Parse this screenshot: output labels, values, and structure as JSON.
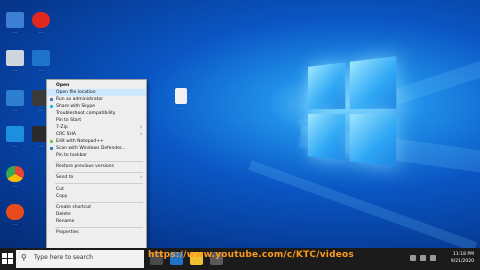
{
  "context_menu": {
    "items": [
      {
        "label": "Open",
        "bold": true,
        "submenu": false
      },
      {
        "label": "Open file location",
        "submenu": false,
        "highlight": true
      },
      {
        "label": "Run as administrator",
        "submenu": false,
        "icon": "shield"
      },
      {
        "label": "Share with Skype",
        "submenu": false,
        "icon": "skype"
      },
      {
        "label": "Troubleshoot compatibility",
        "submenu": false
      },
      {
        "label": "Pin to Start",
        "submenu": false
      },
      {
        "label": "7-Zip",
        "submenu": true
      },
      {
        "label": "CRC SHA",
        "submenu": true
      },
      {
        "label": "Edit with Notepad++",
        "submenu": false,
        "icon": "notepad"
      },
      {
        "label": "Scan with Windows Defender...",
        "submenu": false,
        "icon": "defender"
      },
      {
        "label": "Pin to taskbar",
        "submenu": false
      },
      {
        "separator": true
      },
      {
        "label": "Restore previous versions",
        "submenu": false
      },
      {
        "separator": true
      },
      {
        "label": "Send to",
        "submenu": true
      },
      {
        "separator": true
      },
      {
        "label": "Cut",
        "submenu": false
      },
      {
        "label": "Copy",
        "submenu": false
      },
      {
        "separator": true
      },
      {
        "label": "Create shortcut",
        "submenu": false
      },
      {
        "label": "Delete",
        "submenu": false
      },
      {
        "label": "Rename",
        "submenu": false
      },
      {
        "separator": true
      },
      {
        "label": "Properties",
        "submenu": false
      }
    ]
  },
  "desktop_icons": [
    {
      "label": "...",
      "color": "#3d7fd4"
    },
    {
      "label": "...",
      "color": "#e0281e"
    },
    {
      "label": "...",
      "color": "#cfd6de"
    },
    {
      "label": "...",
      "color": "#1e73c9"
    },
    {
      "label": "...",
      "color": "#2e7fd0"
    },
    {
      "label": "...",
      "color": "#3a3a3a"
    },
    {
      "label": "...",
      "color": "#1d8fe0"
    },
    {
      "label": "...",
      "color": "#2a2a2a"
    },
    {
      "label": "...",
      "color": "#34a853"
    },
    {
      "label": "...",
      "color": "#e84c1c"
    },
    {
      "label": "...",
      "color": "#f1f1f1"
    }
  ],
  "taskbar": {
    "search_placeholder": "Type here to search",
    "watermark": "https://www.youtube.com/c/KTC/videos",
    "time": "11:18 PM",
    "date": "9/21/2020"
  },
  "colors": {
    "accent": "#0a56c4",
    "menu_highlight": "#cce8ff",
    "watermark": "#ff9a1a"
  }
}
